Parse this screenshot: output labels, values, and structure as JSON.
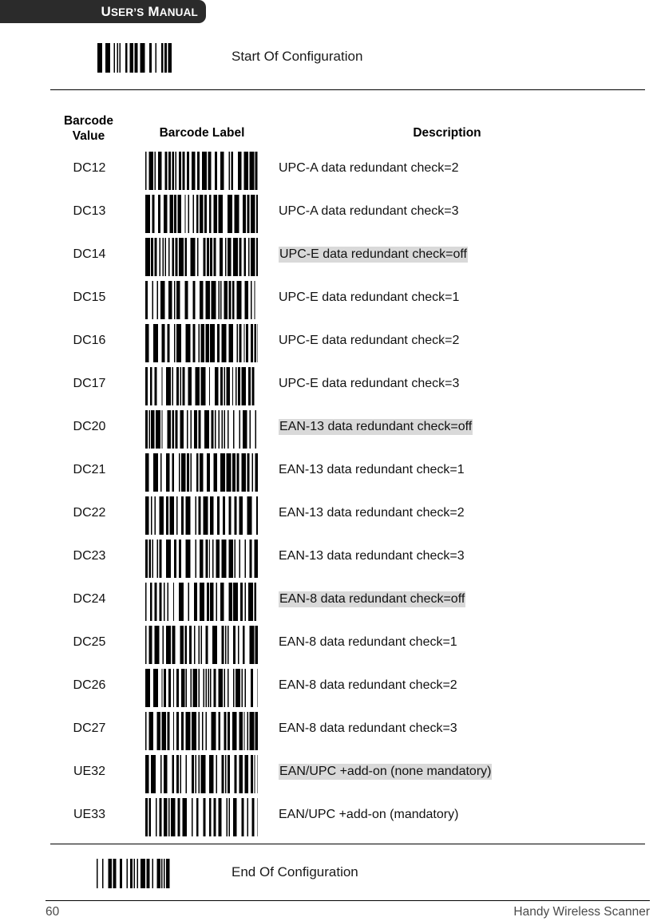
{
  "header": {
    "title": "USER'S MANUAL",
    "title_parts": [
      {
        "big": "U",
        "small": "SER’S"
      },
      {
        "big": "M",
        "small": "ANUAL"
      }
    ]
  },
  "start_config": {
    "barcode_name": "start-of-configuration-barcode",
    "label": "Start Of Configuration"
  },
  "end_config": {
    "barcode_name": "end-of-configuration-barcode",
    "label": "End Of Configuration"
  },
  "table": {
    "headers": {
      "value": "Barcode\nValue",
      "value_line1": "Barcode",
      "value_line2": "Value",
      "label": "Barcode Label",
      "description": "Description"
    },
    "rows": [
      {
        "value": "DC12",
        "description": "UPC-A data redundant check=2",
        "highlighted": false
      },
      {
        "value": "DC13",
        "description": "UPC-A data redundant check=3",
        "highlighted": false
      },
      {
        "value": "DC14",
        "description": "UPC-E data redundant check=off",
        "highlighted": true
      },
      {
        "value": "DC15",
        "description": "UPC-E data redundant check=1",
        "highlighted": false
      },
      {
        "value": "DC16",
        "description": "UPC-E data redundant check=2",
        "highlighted": false
      },
      {
        "value": "DC17",
        "description": "UPC-E data redundant check=3",
        "highlighted": false
      },
      {
        "value": "DC20",
        "description": "EAN-13 data redundant check=off",
        "highlighted": true
      },
      {
        "value": "DC21",
        "description": "EAN-13 data redundant check=1",
        "highlighted": false
      },
      {
        "value": "DC22",
        "description": "EAN-13 data redundant check=2",
        "highlighted": false
      },
      {
        "value": "DC23",
        "description": "EAN-13 data redundant check=3",
        "highlighted": false
      },
      {
        "value": "DC24",
        "description": "EAN-8 data redundant check=off",
        "highlighted": true
      },
      {
        "value": "DC25",
        "description": "EAN-8 data redundant check=1",
        "highlighted": false
      },
      {
        "value": "DC26",
        "description": "EAN-8 data redundant check=2",
        "highlighted": false
      },
      {
        "value": "DC27",
        "description": "EAN-8 data redundant check=3",
        "highlighted": false
      },
      {
        "value": "UE32",
        "description": "EAN/UPC +add-on (none mandatory)",
        "highlighted": true
      },
      {
        "value": "UE33",
        "description": "EAN/UPC +add-on (mandatory)",
        "highlighted": false
      }
    ]
  },
  "footer": {
    "page_number": "60",
    "product_name": "Handy Wireless Scanner"
  },
  "colors": {
    "banner_background": "#2b2b2b",
    "banner_text": "#ffffff",
    "highlight": "#d9d9d9",
    "rule": "#000000",
    "body_text": "#111111",
    "footer_text": "#4a4a4a"
  }
}
